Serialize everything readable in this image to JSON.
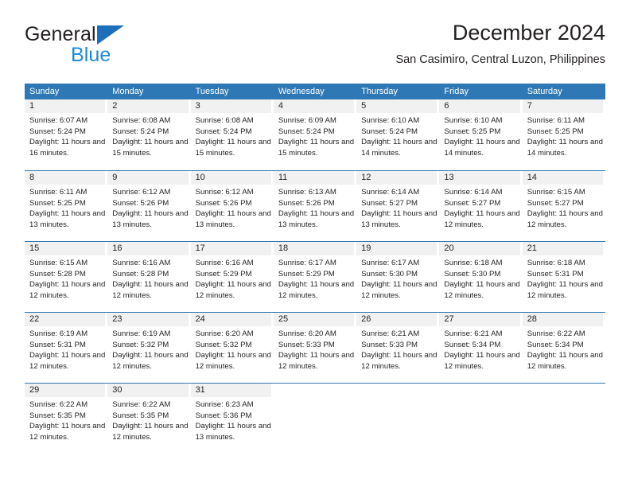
{
  "brand": {
    "name_dark": "General",
    "name_blue": "Blue",
    "accent_blue": "#1c8ad6",
    "triangle_blue": "#1c6fba"
  },
  "header": {
    "title": "December 2024",
    "subtitle": "San Casimiro, Central Luzon, Philippines"
  },
  "theme": {
    "header_bg": "#2e79b5",
    "header_text": "#ffffff",
    "daynum_bg": "#f1f1f1",
    "text": "#231f20"
  },
  "calendar": {
    "weekday_headers": [
      "Sunday",
      "Monday",
      "Tuesday",
      "Wednesday",
      "Thursday",
      "Friday",
      "Saturday"
    ],
    "weeks": [
      [
        {
          "day": "1",
          "sunrise": "Sunrise: 6:07 AM",
          "sunset": "Sunset: 5:24 PM",
          "daylight": "Daylight: 11 hours and 16 minutes."
        },
        {
          "day": "2",
          "sunrise": "Sunrise: 6:08 AM",
          "sunset": "Sunset: 5:24 PM",
          "daylight": "Daylight: 11 hours and 15 minutes."
        },
        {
          "day": "3",
          "sunrise": "Sunrise: 6:08 AM",
          "sunset": "Sunset: 5:24 PM",
          "daylight": "Daylight: 11 hours and 15 minutes."
        },
        {
          "day": "4",
          "sunrise": "Sunrise: 6:09 AM",
          "sunset": "Sunset: 5:24 PM",
          "daylight": "Daylight: 11 hours and 15 minutes."
        },
        {
          "day": "5",
          "sunrise": "Sunrise: 6:10 AM",
          "sunset": "Sunset: 5:24 PM",
          "daylight": "Daylight: 11 hours and 14 minutes."
        },
        {
          "day": "6",
          "sunrise": "Sunrise: 6:10 AM",
          "sunset": "Sunset: 5:25 PM",
          "daylight": "Daylight: 11 hours and 14 minutes."
        },
        {
          "day": "7",
          "sunrise": "Sunrise: 6:11 AM",
          "sunset": "Sunset: 5:25 PM",
          "daylight": "Daylight: 11 hours and 14 minutes."
        }
      ],
      [
        {
          "day": "8",
          "sunrise": "Sunrise: 6:11 AM",
          "sunset": "Sunset: 5:25 PM",
          "daylight": "Daylight: 11 hours and 13 minutes."
        },
        {
          "day": "9",
          "sunrise": "Sunrise: 6:12 AM",
          "sunset": "Sunset: 5:26 PM",
          "daylight": "Daylight: 11 hours and 13 minutes."
        },
        {
          "day": "10",
          "sunrise": "Sunrise: 6:12 AM",
          "sunset": "Sunset: 5:26 PM",
          "daylight": "Daylight: 11 hours and 13 minutes."
        },
        {
          "day": "11",
          "sunrise": "Sunrise: 6:13 AM",
          "sunset": "Sunset: 5:26 PM",
          "daylight": "Daylight: 11 hours and 13 minutes."
        },
        {
          "day": "12",
          "sunrise": "Sunrise: 6:14 AM",
          "sunset": "Sunset: 5:27 PM",
          "daylight": "Daylight: 11 hours and 13 minutes."
        },
        {
          "day": "13",
          "sunrise": "Sunrise: 6:14 AM",
          "sunset": "Sunset: 5:27 PM",
          "daylight": "Daylight: 11 hours and 12 minutes."
        },
        {
          "day": "14",
          "sunrise": "Sunrise: 6:15 AM",
          "sunset": "Sunset: 5:27 PM",
          "daylight": "Daylight: 11 hours and 12 minutes."
        }
      ],
      [
        {
          "day": "15",
          "sunrise": "Sunrise: 6:15 AM",
          "sunset": "Sunset: 5:28 PM",
          "daylight": "Daylight: 11 hours and 12 minutes."
        },
        {
          "day": "16",
          "sunrise": "Sunrise: 6:16 AM",
          "sunset": "Sunset: 5:28 PM",
          "daylight": "Daylight: 11 hours and 12 minutes."
        },
        {
          "day": "17",
          "sunrise": "Sunrise: 6:16 AM",
          "sunset": "Sunset: 5:29 PM",
          "daylight": "Daylight: 11 hours and 12 minutes."
        },
        {
          "day": "18",
          "sunrise": "Sunrise: 6:17 AM",
          "sunset": "Sunset: 5:29 PM",
          "daylight": "Daylight: 11 hours and 12 minutes."
        },
        {
          "day": "19",
          "sunrise": "Sunrise: 6:17 AM",
          "sunset": "Sunset: 5:30 PM",
          "daylight": "Daylight: 11 hours and 12 minutes."
        },
        {
          "day": "20",
          "sunrise": "Sunrise: 6:18 AM",
          "sunset": "Sunset: 5:30 PM",
          "daylight": "Daylight: 11 hours and 12 minutes."
        },
        {
          "day": "21",
          "sunrise": "Sunrise: 6:18 AM",
          "sunset": "Sunset: 5:31 PM",
          "daylight": "Daylight: 11 hours and 12 minutes."
        }
      ],
      [
        {
          "day": "22",
          "sunrise": "Sunrise: 6:19 AM",
          "sunset": "Sunset: 5:31 PM",
          "daylight": "Daylight: 11 hours and 12 minutes."
        },
        {
          "day": "23",
          "sunrise": "Sunrise: 6:19 AM",
          "sunset": "Sunset: 5:32 PM",
          "daylight": "Daylight: 11 hours and 12 minutes."
        },
        {
          "day": "24",
          "sunrise": "Sunrise: 6:20 AM",
          "sunset": "Sunset: 5:32 PM",
          "daylight": "Daylight: 11 hours and 12 minutes."
        },
        {
          "day": "25",
          "sunrise": "Sunrise: 6:20 AM",
          "sunset": "Sunset: 5:33 PM",
          "daylight": "Daylight: 11 hours and 12 minutes."
        },
        {
          "day": "26",
          "sunrise": "Sunrise: 6:21 AM",
          "sunset": "Sunset: 5:33 PM",
          "daylight": "Daylight: 11 hours and 12 minutes."
        },
        {
          "day": "27",
          "sunrise": "Sunrise: 6:21 AM",
          "sunset": "Sunset: 5:34 PM",
          "daylight": "Daylight: 11 hours and 12 minutes."
        },
        {
          "day": "28",
          "sunrise": "Sunrise: 6:22 AM",
          "sunset": "Sunset: 5:34 PM",
          "daylight": "Daylight: 11 hours and 12 minutes."
        }
      ],
      [
        {
          "day": "29",
          "sunrise": "Sunrise: 6:22 AM",
          "sunset": "Sunset: 5:35 PM",
          "daylight": "Daylight: 11 hours and 12 minutes."
        },
        {
          "day": "30",
          "sunrise": "Sunrise: 6:22 AM",
          "sunset": "Sunset: 5:35 PM",
          "daylight": "Daylight: 11 hours and 12 minutes."
        },
        {
          "day": "31",
          "sunrise": "Sunrise: 6:23 AM",
          "sunset": "Sunset: 5:36 PM",
          "daylight": "Daylight: 11 hours and 13 minutes."
        },
        {
          "day": "",
          "sunrise": "",
          "sunset": "",
          "daylight": ""
        },
        {
          "day": "",
          "sunrise": "",
          "sunset": "",
          "daylight": ""
        },
        {
          "day": "",
          "sunrise": "",
          "sunset": "",
          "daylight": ""
        },
        {
          "day": "",
          "sunrise": "",
          "sunset": "",
          "daylight": ""
        }
      ]
    ]
  }
}
